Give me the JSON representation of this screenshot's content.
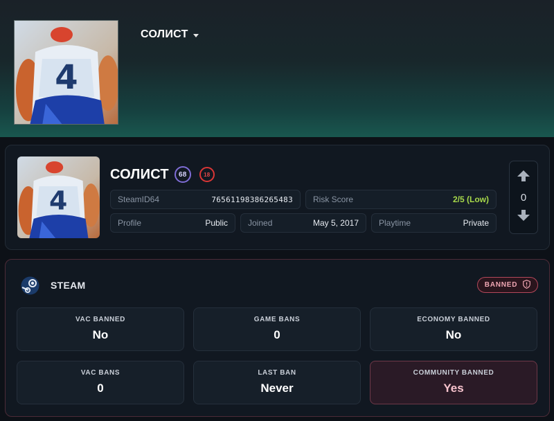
{
  "header": {
    "username": "СОЛИСТ"
  },
  "profile": {
    "name": "СОЛИСТ",
    "level": "68",
    "age_badge": "18",
    "fields": {
      "steamid_label": "SteamID64",
      "steamid_value": "76561198386265483",
      "risk_label": "Risk Score",
      "risk_value": "2/5 (Low)",
      "profile_label": "Profile",
      "profile_value": "Public",
      "joined_label": "Joined",
      "joined_value": "May 5, 2017",
      "playtime_label": "Playtime",
      "playtime_value": "Private"
    },
    "votes": "0"
  },
  "steam": {
    "title": "STEAM",
    "status_badge": "BANNED",
    "stats": [
      {
        "label": "VAC BANNED",
        "value": "No"
      },
      {
        "label": "GAME BANS",
        "value": "0"
      },
      {
        "label": "ECONOMY BANNED",
        "value": "No"
      },
      {
        "label": "VAC BANS",
        "value": "0"
      },
      {
        "label": "LAST BAN",
        "value": "Never"
      },
      {
        "label": "COMMUNITY BANNED",
        "value": "Yes"
      }
    ]
  },
  "colors": {
    "accent_green": "#a7d94a",
    "level_ring": "#7f6dd6",
    "age_ring": "#d93636",
    "ban_border": "#b4485b"
  },
  "icons": [
    "chevron-down-icon",
    "upvote-arrow-icon",
    "downvote-arrow-icon",
    "steam-logo-icon",
    "shield-alert-icon"
  ]
}
